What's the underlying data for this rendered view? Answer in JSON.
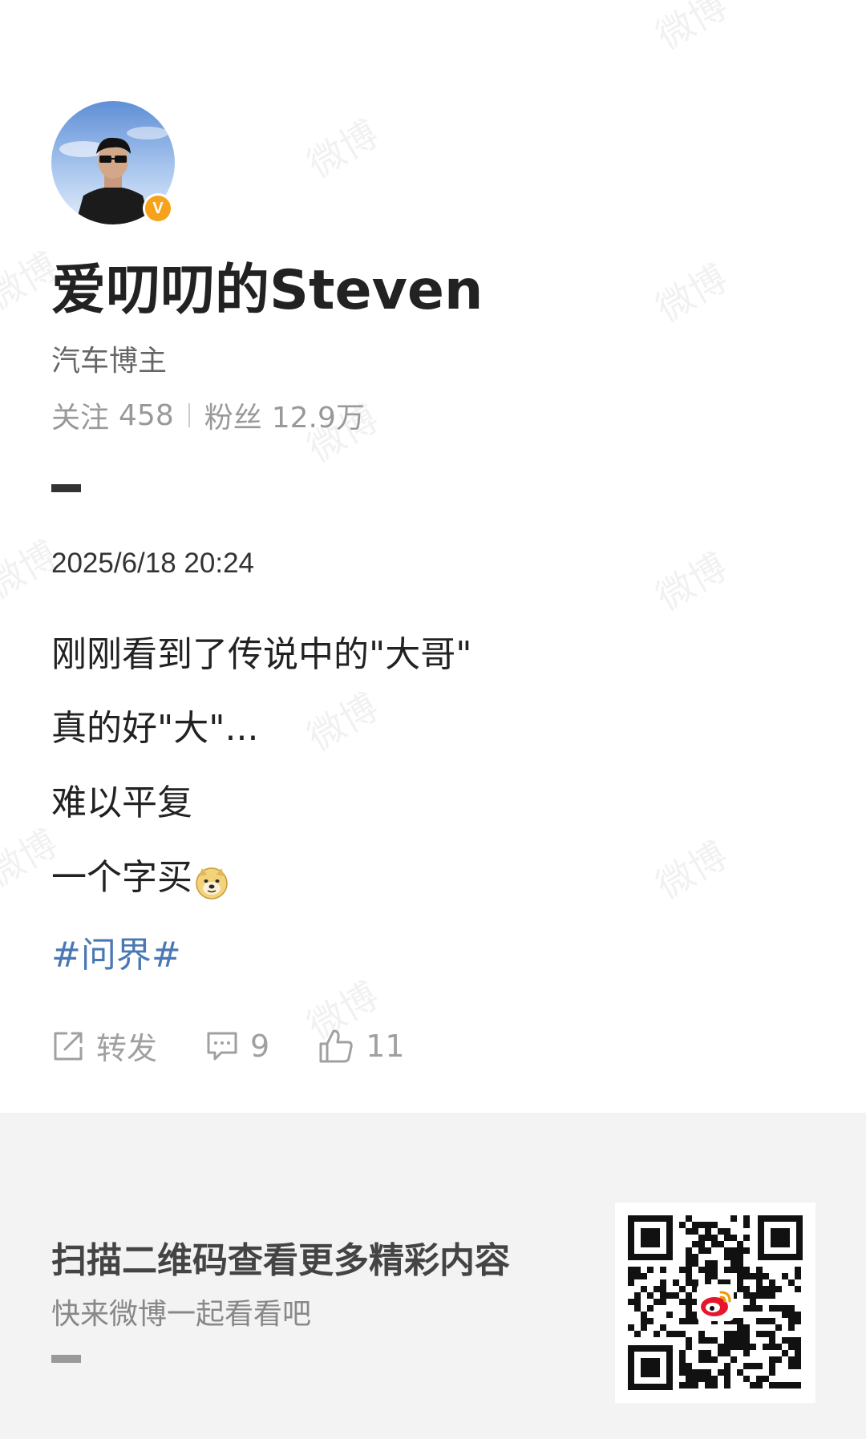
{
  "profile": {
    "username": "爱叨叨的Steven",
    "title": "汽车博主",
    "following_label": "关注",
    "following_count": "458",
    "followers_label": "粉丝",
    "followers_count": "12.9万"
  },
  "post": {
    "timestamp": "2025/6/18 20:24",
    "lines": [
      "刚刚看到了传说中的\"大哥\"",
      "真的好\"大\"...",
      "难以平复",
      "一个字买"
    ],
    "emoji": "doge-emoji",
    "hashtag": "#问界#",
    "actions": {
      "repost_label": "转发",
      "comment_count": "9",
      "like_count": "11"
    }
  },
  "footer": {
    "title": "扫描二维码查看更多精彩内容",
    "subtitle": "快来微博一起看看吧"
  },
  "watermark_text": "微博",
  "colors": {
    "hashtag": "#4a78b4",
    "verified_badge": "#f6a21a",
    "footer_bg": "#f3f3f3",
    "weibo_red": "#e6162d"
  }
}
